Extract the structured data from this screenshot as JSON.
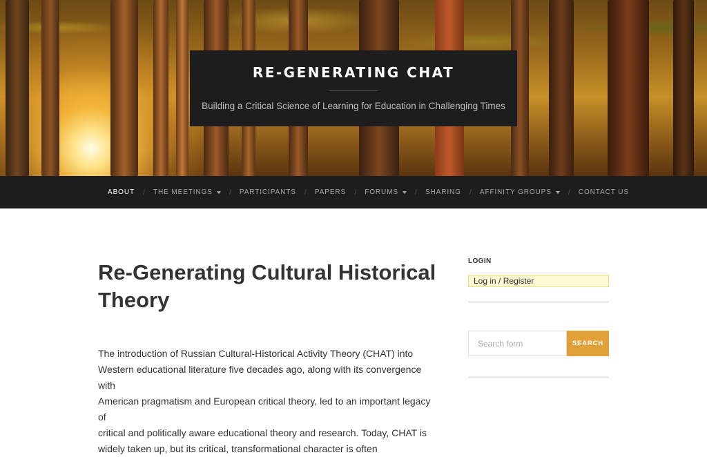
{
  "header": {
    "site_title": "RE-GENERATING CHAT",
    "tagline": "Building a Critical Science of Learning for Education in Challenging Times"
  },
  "nav": {
    "items": [
      {
        "label": "ABOUT",
        "active": true,
        "has_dropdown": false
      },
      {
        "label": "THE MEETINGS",
        "active": false,
        "has_dropdown": true
      },
      {
        "label": "PARTICIPANTS",
        "active": false,
        "has_dropdown": false
      },
      {
        "label": "PAPERS",
        "active": false,
        "has_dropdown": false
      },
      {
        "label": "FORUMS",
        "active": false,
        "has_dropdown": true
      },
      {
        "label": "SHARING",
        "active": false,
        "has_dropdown": false
      },
      {
        "label": "AFFINITY GROUPS",
        "active": false,
        "has_dropdown": true
      },
      {
        "label": "CONTACT US",
        "active": false,
        "has_dropdown": false
      }
    ],
    "separator": "/"
  },
  "main": {
    "title": "Re-Generating Cultural Historical Theory",
    "body_lines": [
      "The introduction of Russian Cultural-Historical Activity Theory (CHAT) into",
      "Western educational literature five decades ago, along with its convergence with",
      "American pragmatism and European critical theory, led to an important legacy of",
      "critical and politically aware educational theory and research. Today, CHAT is",
      "widely taken up, but its critical, transformational character is often"
    ]
  },
  "sidebar": {
    "login_heading": "LOGIN",
    "login_link": "Log in",
    "login_sep": "/",
    "register_link": "Register",
    "search_placeholder": "Search form",
    "search_button": "SEARCH"
  },
  "colors": {
    "nav_bg": "#1d1d1d",
    "accent": "#e2a038",
    "login_highlight": "#fdf9d5"
  }
}
